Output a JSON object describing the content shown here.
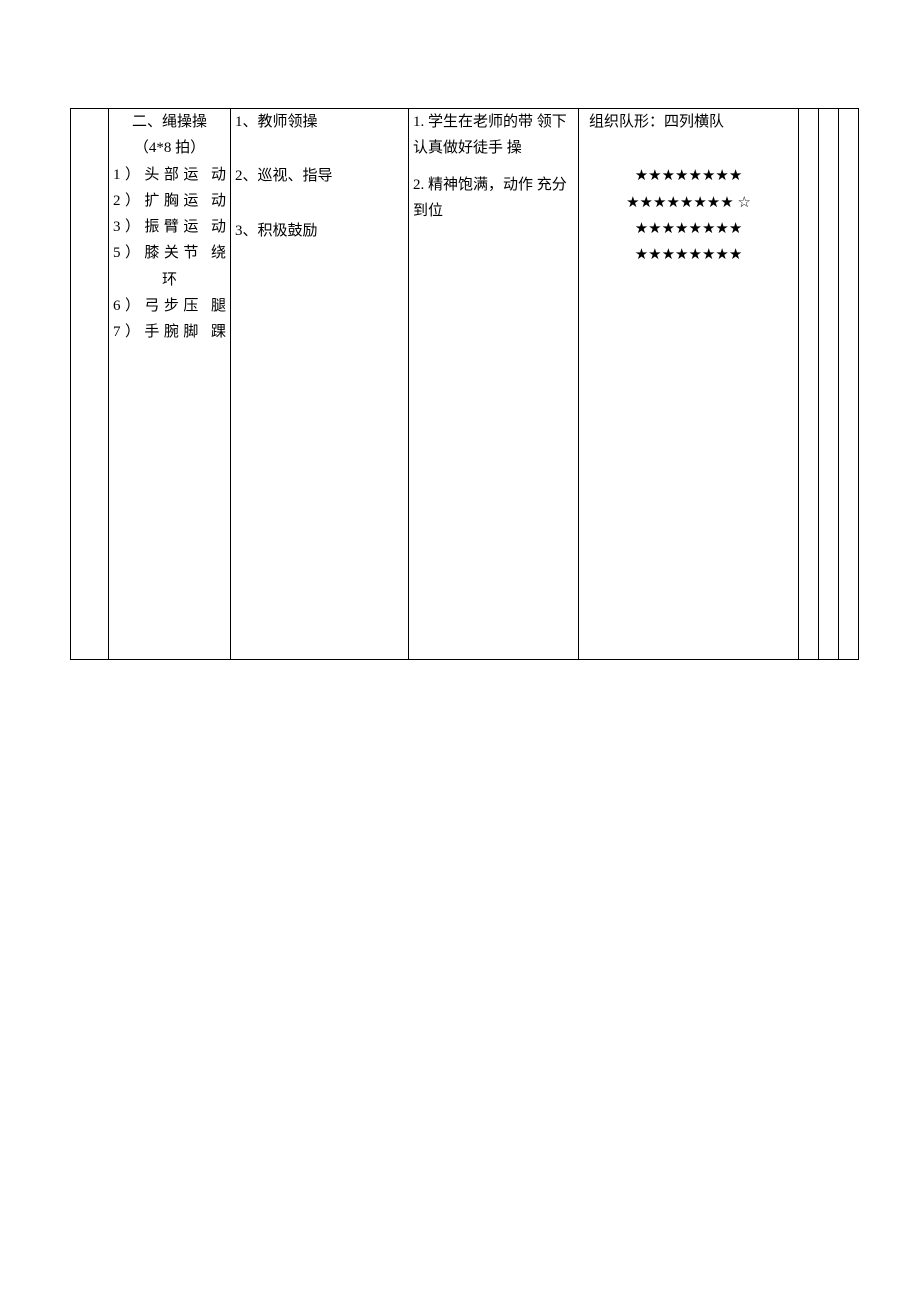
{
  "content": {
    "title": "二、绳操操",
    "subtitle": "（4*8 拍）",
    "items": [
      "1）头部运  动",
      "2）扩胸运  动",
      "3）振臂运  动",
      "5）膝关节  绕",
      "环",
      "6）弓步压  腿",
      "7）手腕脚  踝"
    ]
  },
  "teacher": {
    "items": [
      "1、教师领操",
      "2、巡视、指导",
      "3、积极鼓励"
    ]
  },
  "student": {
    "items": [
      "1. 学生在老师的带  领下认真做好徒手  操",
      "2. 精神饱满，动作 充分到位"
    ]
  },
  "org": {
    "caption": "组织队形：四列横队",
    "rows": [
      "★★★★★★★★",
      "★★★★★★★★  ☆",
      "★★★★★★★★",
      "★★★★★★★★"
    ]
  }
}
